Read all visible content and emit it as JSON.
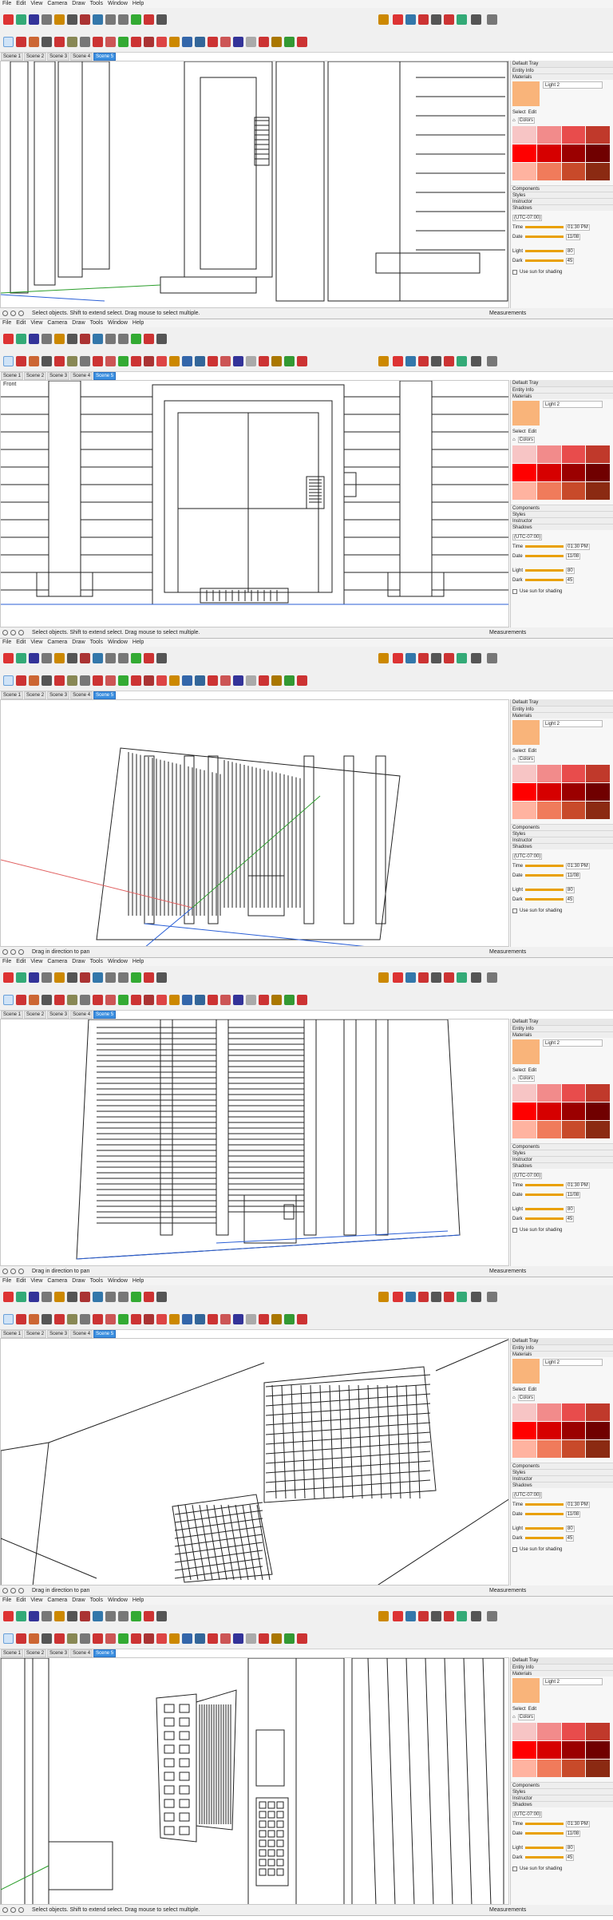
{
  "menus": [
    "File",
    "Edit",
    "View",
    "Camera",
    "Draw",
    "Tools",
    "Window",
    "Help"
  ],
  "scene_tabs": [
    "Scene 1",
    "Scene 2",
    "Scene 3",
    "Scene 4",
    "Scene 5"
  ],
  "tray": {
    "title": "Default Tray",
    "entity_info": "Entity Info",
    "materials": "Materials",
    "material_name": "Light 2",
    "select_label": "Select",
    "edit_label": "Edit",
    "library": "Colors",
    "components": "Components",
    "styles": "Styles",
    "instructor": "Instructor",
    "shadows": "Shadows",
    "timezone": "(UTC-07:00)",
    "time_label": "Time",
    "time_value": "01:30 PM",
    "date_label": "Date",
    "date_value": "11/08",
    "light_label": "Light",
    "light_value": "80",
    "dark_label": "Dark",
    "dark_value": "45",
    "use_sun": "Use sun for shading"
  },
  "colors": {
    "swatch": "#f9b47a",
    "accent": "#3b8fe0",
    "grid": [
      "#f7c5c5",
      "#f28b8b",
      "#e84c4c",
      "#c0392b",
      "#ff0000",
      "#d60000",
      "#9b0000",
      "#700000",
      "#ffb3a0",
      "#f07b5b",
      "#c84a2a",
      "#8b2a12"
    ]
  },
  "panes": [
    {
      "status": "Select objects. Shift to extend select. Drag mouse to select multiple.",
      "active_scene": 4,
      "view_label": ""
    },
    {
      "status": "Select objects. Shift to extend select. Drag mouse to select multiple.",
      "active_scene": 4,
      "view_label": "Front"
    },
    {
      "status": "Drag in direction to pan",
      "active_scene": 4,
      "view_label": ""
    },
    {
      "status": "Drag in direction to pan",
      "active_scene": 4,
      "view_label": ""
    },
    {
      "status": "Drag in direction to pan",
      "active_scene": 4,
      "view_label": ""
    },
    {
      "status": "Select objects. Shift to extend select. Drag mouse to select multiple.",
      "active_scene": 4,
      "view_label": ""
    }
  ],
  "measurements_label": "Measurements"
}
